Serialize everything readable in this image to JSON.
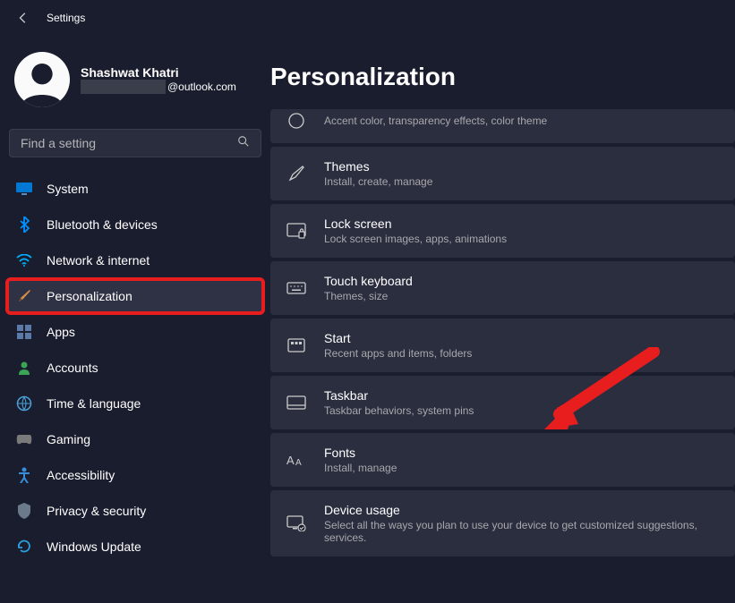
{
  "header": {
    "title": "Settings"
  },
  "profile": {
    "name": "Shashwat Khatri",
    "email_suffix": "@outlook.com"
  },
  "search": {
    "placeholder": "Find a setting"
  },
  "nav": {
    "items": [
      {
        "id": "system",
        "label": "System"
      },
      {
        "id": "bluetooth",
        "label": "Bluetooth & devices"
      },
      {
        "id": "network",
        "label": "Network & internet"
      },
      {
        "id": "personalization",
        "label": "Personalization"
      },
      {
        "id": "apps",
        "label": "Apps"
      },
      {
        "id": "accounts",
        "label": "Accounts"
      },
      {
        "id": "time",
        "label": "Time & language"
      },
      {
        "id": "gaming",
        "label": "Gaming"
      },
      {
        "id": "accessibility",
        "label": "Accessibility"
      },
      {
        "id": "privacy",
        "label": "Privacy & security"
      },
      {
        "id": "update",
        "label": "Windows Update"
      }
    ]
  },
  "page": {
    "title": "Personalization"
  },
  "cards": [
    {
      "id": "colors",
      "title": "",
      "sub": "Accent color, transparency effects, color theme"
    },
    {
      "id": "themes",
      "title": "Themes",
      "sub": "Install, create, manage"
    },
    {
      "id": "lockscreen",
      "title": "Lock screen",
      "sub": "Lock screen images, apps, animations"
    },
    {
      "id": "touchkb",
      "title": "Touch keyboard",
      "sub": "Themes, size"
    },
    {
      "id": "start",
      "title": "Start",
      "sub": "Recent apps and items, folders"
    },
    {
      "id": "taskbar",
      "title": "Taskbar",
      "sub": "Taskbar behaviors, system pins"
    },
    {
      "id": "fonts",
      "title": "Fonts",
      "sub": "Install, manage"
    },
    {
      "id": "deviceusage",
      "title": "Device usage",
      "sub": "Select all the ways you plan to use your device to get customized suggestions, services."
    }
  ]
}
